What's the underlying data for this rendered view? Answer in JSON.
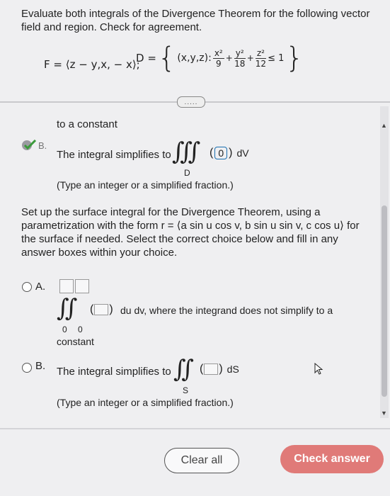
{
  "question": {
    "line1": "Evaluate both integrals of the Divergence Theorem for the following vector",
    "line2": "field and region. Check for agreement.",
    "field_lhs": "F = ⟨z − y,x, − x⟩;",
    "region_lhs": "D =",
    "region_set_start": "(x,y,z):",
    "frac1_num": "x²",
    "frac1_den": "9",
    "frac2_num": "y²",
    "frac2_den": "18",
    "frac3_num": "z²",
    "frac3_den": "12",
    "ineq": "≤ 1",
    "more_button": "....."
  },
  "part1": {
    "fragment": "to a constant",
    "choice_letter": "B.",
    "integral_text": "The integral simplifies to",
    "integral_symbol": "∭",
    "integrand_value": "0",
    "dv": "dV",
    "region_label": "D",
    "hint": "(Type an integer or a simplified fraction.)"
  },
  "part2": {
    "instruction": "Set up the surface integral for the Divergence Theorem, using a parametrization with the form r = ⟨a sin u cos v, b sin u sin v, c cos u⟩ for the surface if needed. Select the correct choice below and fill in any answer boxes within your choice.",
    "instruction_lines": [
      "Set up the surface integral for the Divergence Theorem, using a",
      "parametrization with the form r = ⟨a sin u cos v, b sin u sin v, c cos u⟩  for",
      "the surface if needed. Select the correct choice below and fill in any",
      "answer boxes within your choice."
    ],
    "option_a": {
      "letter": "A.",
      "integral_symbol": "∫∫",
      "lower1": "0",
      "lower2": "0",
      "tail": "du dv, where the integrand does not simplify to a",
      "tail2": "constant"
    },
    "option_b": {
      "letter": "B.",
      "text": "The integral simplifies to",
      "integral_symbol": "∬",
      "ds": "dS",
      "region_label": "S",
      "hint": "(Type an integer or a simplified fraction.)"
    }
  },
  "buttons": {
    "clear_all": "Clear all",
    "check_answer": "Check answer"
  },
  "colors": {
    "check_mark": "#3a9a3a",
    "check_button": "#e07a78",
    "filled_box_border": "#1a6fb0"
  }
}
